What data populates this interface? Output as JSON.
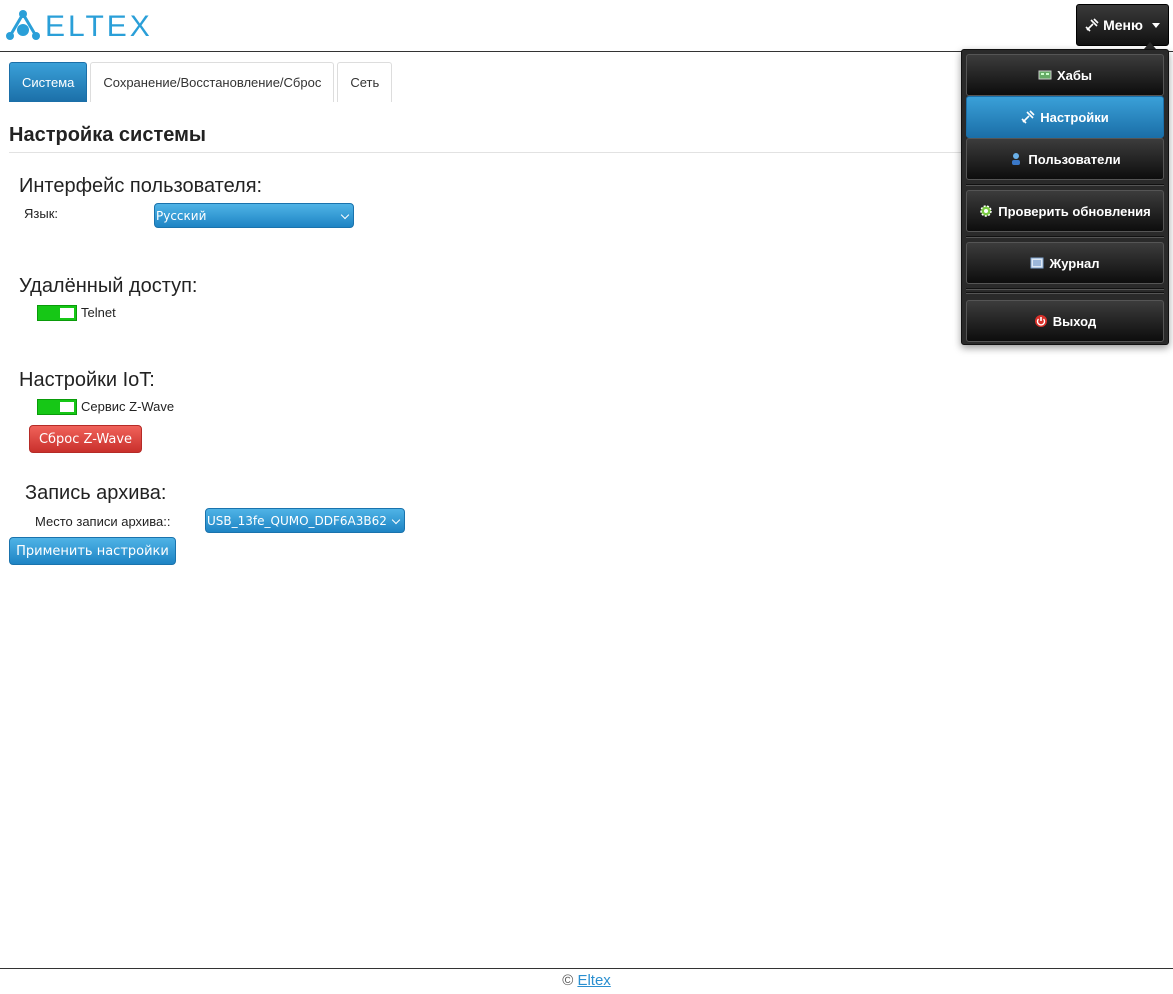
{
  "header": {
    "logo_text": "ELTEX",
    "menu_label": "Меню",
    "brand_color": "#3aa0d8"
  },
  "tabs": [
    {
      "label": "Система",
      "active": true
    },
    {
      "label": "Сохранение/Восстановление/Сброс",
      "active": false
    },
    {
      "label": "Сеть",
      "active": false
    }
  ],
  "page": {
    "title": "Настройка системы"
  },
  "ui_section": {
    "heading": "Интерфейс пользователя:",
    "language_label": "Язык:",
    "language_value": "Русский"
  },
  "remote_section": {
    "heading": "Удалённый доступ:",
    "telnet_label": "Telnet",
    "telnet_enabled": true
  },
  "iot_section": {
    "heading": "Настройки IoT:",
    "zwave_label": "Сервис Z-Wave",
    "zwave_enabled": true,
    "reset_button": "Сброс Z-Wave"
  },
  "archive_section": {
    "heading": "Запись архива:",
    "location_label": "Место записи архива::",
    "location_value": "USB_13fe_QUMO_DDF6A3B62"
  },
  "apply_button": "Применить настройки",
  "menu": {
    "items": [
      {
        "label": "Хабы",
        "icon": "hub-icon",
        "active": false
      },
      {
        "label": "Настройки",
        "icon": "tools-icon",
        "active": true
      },
      {
        "label": "Пользователи",
        "icon": "users-icon",
        "active": false
      },
      {
        "label": "Проверить обновления",
        "icon": "update-gear-icon",
        "active": false
      },
      {
        "label": "Журнал",
        "icon": "journal-icon",
        "active": false
      },
      {
        "label": "Выход",
        "icon": "power-icon",
        "active": false
      }
    ]
  },
  "footer": {
    "copyright": "©",
    "link": "Eltex"
  }
}
